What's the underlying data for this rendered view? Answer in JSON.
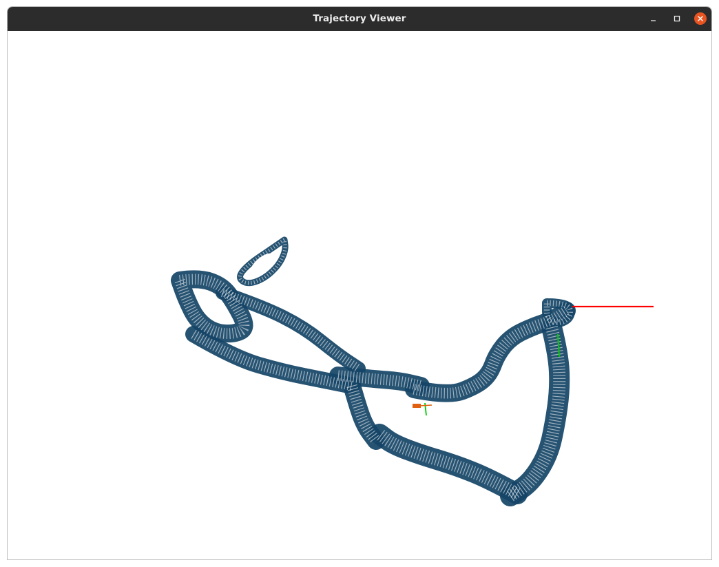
{
  "window": {
    "title": "Trajectory Viewer",
    "controls": {
      "minimize_icon": "minimize-icon",
      "maximize_icon": "maximize-icon",
      "close_icon": "close-icon"
    }
  },
  "scene": {
    "background": "#ffffff",
    "mesh_color": "#154466",
    "axes": {
      "x_color": "#ff0000",
      "y_color": "#00cc00",
      "camera_marker_color": "#e06010"
    }
  }
}
